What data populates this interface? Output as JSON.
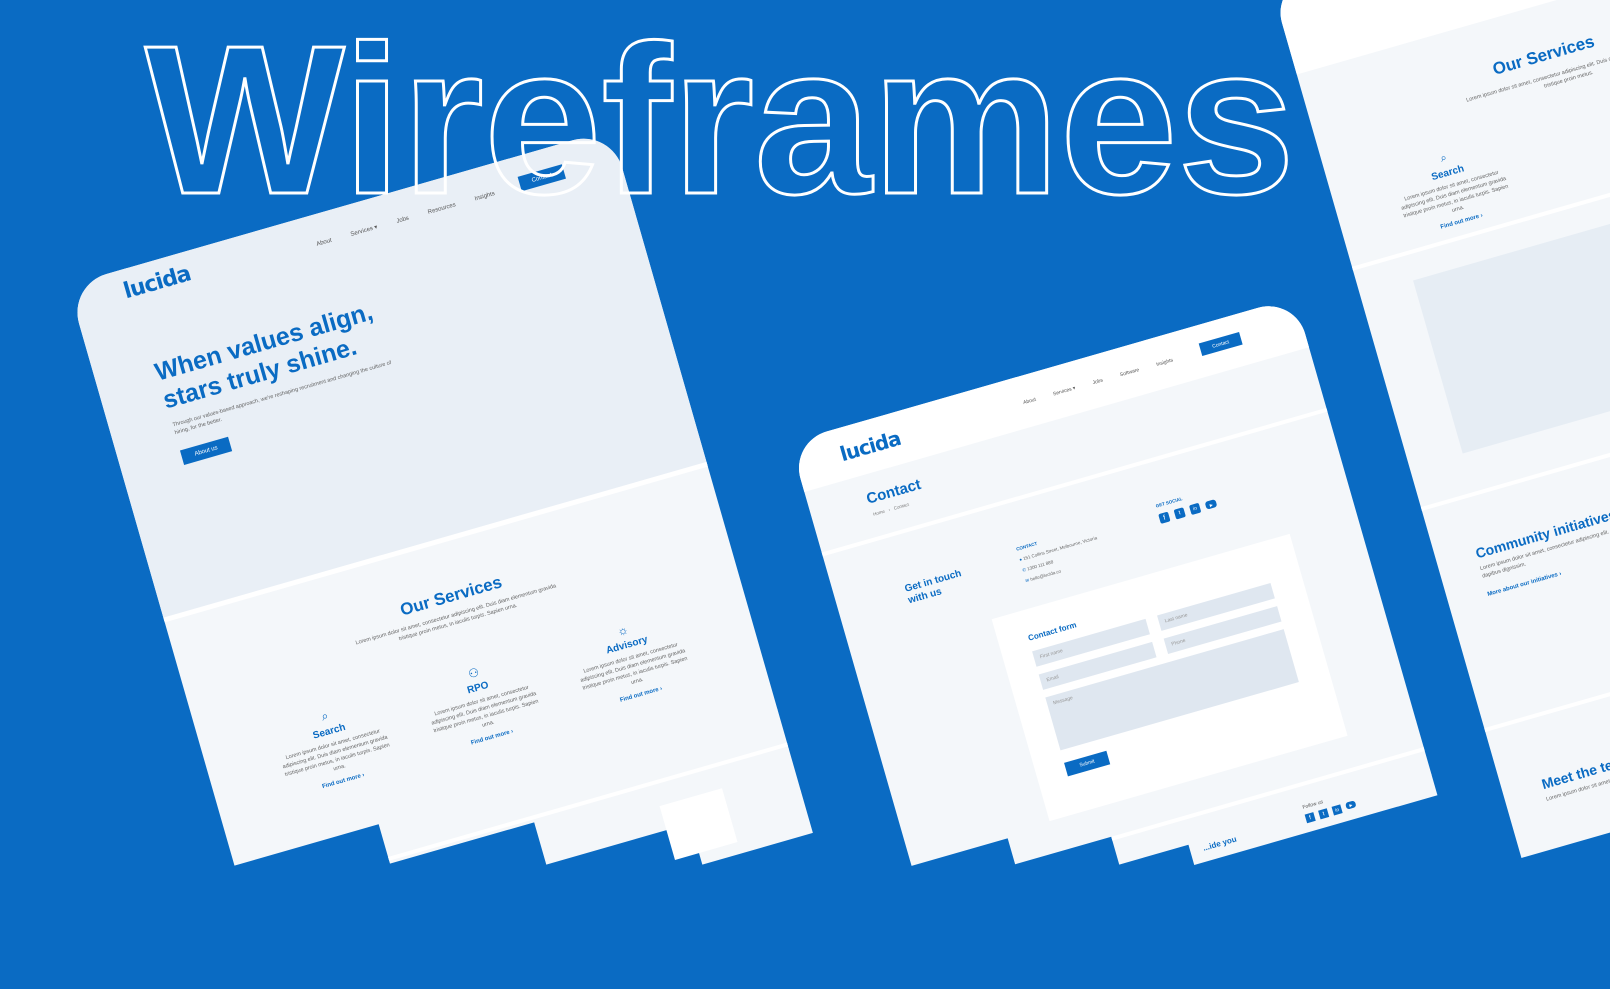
{
  "headline_overlay": "Wireframes",
  "colors": {
    "background": "#0a6bc3",
    "brand": "#0a6bc3",
    "hero": "#e9eff6",
    "section": "#f4f7fa"
  },
  "home": {
    "logo": "lucida",
    "nav": [
      "About",
      "Services ▾",
      "Jobs",
      "Resources",
      "Insights"
    ],
    "nav_button": "Contact",
    "hero_title_1": "When values align,",
    "hero_title_2": "stars truly shine.",
    "hero_sub": "Through our values-based approach, we're reshaping recruitment and changing the culture of hiring, for the better.",
    "hero_button": "About us",
    "services_title": "Our Services",
    "services_intro": "Lorem ipsum dolor sit amet, consectetur adipiscing elit. Duis diam elementum gravida tristique proin metus, in iaculis turpis. Sapien urna.",
    "services": [
      {
        "icon": "search-icon",
        "title": "Search",
        "text": "Lorem ipsum dolor sit amet, consectetur adipiscing elit. Duis diam elementum gravida tristique proin metus, in iaculis turpis. Sapien urna.",
        "link": "Find out more ›"
      },
      {
        "icon": "people-icon",
        "title": "RPO",
        "text": "Lorem ipsum dolor sit amet, consectetur adipiscing elit. Duis diam elementum gravida tristique proin metus, in iaculis turpis. Sapien urna.",
        "link": "Find out more ›"
      },
      {
        "icon": "lightbulb-icon",
        "title": "Advisory",
        "text": "Lorem ipsum dolor sit amet, consectetur adipiscing elit. Duis diam elementum gravida tristique proin metus, in iaculis turpis. Sapien urna.",
        "link": "Find out more ›"
      }
    ]
  },
  "contact": {
    "logo": "lucida",
    "nav": [
      "About",
      "Services ▾",
      "Jobs",
      "Software",
      "Insights"
    ],
    "nav_button": "Contact",
    "title": "Contact",
    "breadcrumb": [
      "Home",
      "›",
      "Contact"
    ],
    "get_in_touch": "Get in touch with us",
    "contact_label": "CONTACT",
    "address": "151 Collins Street, Melbourne, Victoria",
    "phone": "1300 111 888",
    "email": "hello@lucida.co",
    "social_label": "GET SOCIAL",
    "form_title": "Contact form",
    "fields": {
      "first": "First name",
      "last": "Last name",
      "email": "Email",
      "phone": "Phone",
      "message": "Message"
    },
    "submit": "Submit",
    "follow": "Follow us",
    "footer_partial": "...ide you"
  },
  "right": {
    "services_title": "Our Services",
    "intro": "Lorem ipsum dolor sit amet, consectetur adipiscing elit. Duis diam elementum gravida tristique proin metus.",
    "search_title": "Search",
    "search_text": "Lorem ipsum dolor sit amet, consectetur adipiscing elit. Duis diam elementum gravida tristique proin metus, in iaculis turpis. Sapien urna.",
    "search_link": "Find out more ›",
    "community_title": "Community initiatives",
    "community_text": "Lorem ipsum dolor sit amet, consectetur adipiscing elit. Ms habitant, scelerisque dapibus dignissim.",
    "community_link": "More about our initiatives ›",
    "meet_title": "Meet the team",
    "meet_text": "Lorem ipsum dolor sit amet, consectetur adipiscing elit."
  }
}
